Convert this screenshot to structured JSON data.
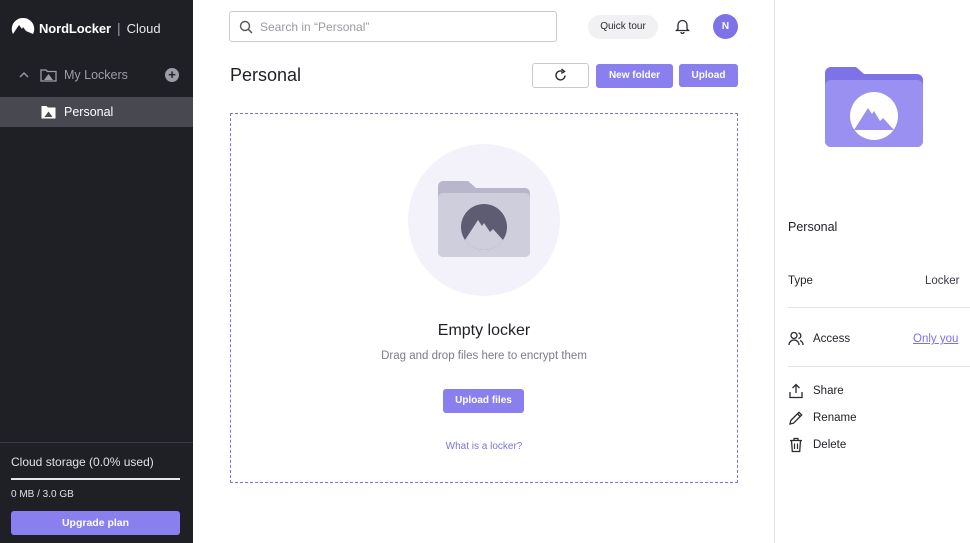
{
  "brand": {
    "name": "NordLocker",
    "separator": "|",
    "product": "Cloud"
  },
  "sidebar": {
    "lockers_label": "My Lockers",
    "items": [
      {
        "label": "Personal",
        "selected": true
      }
    ]
  },
  "storage": {
    "title": "Cloud storage (0.0% used)",
    "used_fraction": 0.0,
    "size": "0 MB / 3.0 GB",
    "upgrade_label": "Upgrade plan"
  },
  "header": {
    "search_placeholder": "Search in “Personal”",
    "quick_tour": "Quick tour",
    "avatar_initial": "N"
  },
  "toolbar": {
    "page_title": "Personal",
    "refresh_icon": "refresh-icon",
    "new_folder": "New folder",
    "upload": "Upload"
  },
  "empty_state": {
    "title": "Empty locker",
    "subtitle": "Drag and drop files here to encrypt them",
    "upload_button": "Upload files",
    "help_link": "What is a locker?"
  },
  "details": {
    "name": "Personal",
    "type_label": "Type",
    "type_value": "Locker",
    "access_label": "Access",
    "access_value": "Only you",
    "actions": [
      "Share",
      "Rename",
      "Delete"
    ]
  },
  "colors": {
    "accent": "#8a7fef",
    "sidebar_bg": "#1f2026",
    "selected_bg": "#474850"
  }
}
